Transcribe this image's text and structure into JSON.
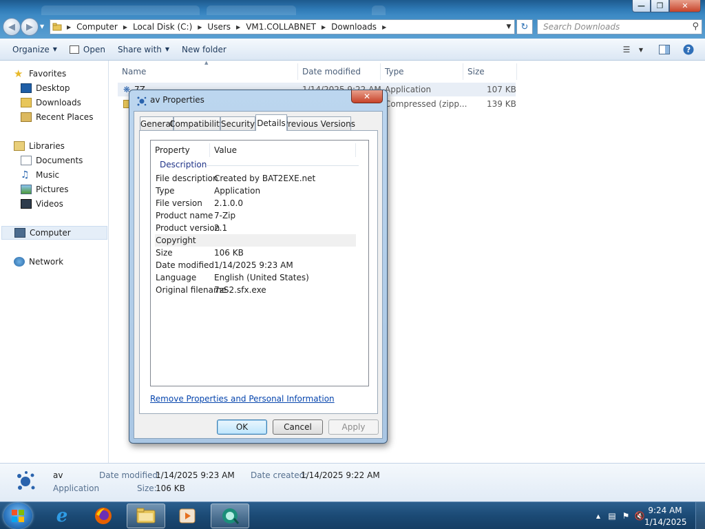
{
  "explorer": {
    "breadcrumb": [
      "Computer",
      "Local Disk (C:)",
      "Users",
      "VM1.COLLABNET",
      "Downloads"
    ],
    "search_placeholder": "Search Downloads",
    "toolbar": {
      "organize": "Organize",
      "open": "Open",
      "share_with": "Share with",
      "new_folder": "New folder"
    },
    "nav": {
      "favorites": "Favorites",
      "desktop": "Desktop",
      "downloads": "Downloads",
      "recent_places": "Recent Places",
      "libraries": "Libraries",
      "documents": "Documents",
      "music": "Music",
      "pictures": "Pictures",
      "videos": "Videos",
      "computer": "Computer",
      "network": "Network"
    },
    "columns": {
      "name": "Name",
      "date_modified": "Date modified",
      "type": "Type",
      "size": "Size"
    },
    "files": [
      {
        "name": "7Z",
        "date": "1/14/2025 9:22 AM",
        "type": "Application",
        "size": "107 KB"
      },
      {
        "name": "",
        "date": "",
        "type": "Compressed (zipp...",
        "size": "139 KB"
      }
    ]
  },
  "details_pane": {
    "name": "av",
    "type": "Application",
    "date_modified_label": "Date modified:",
    "date_modified": "1/14/2025 9:23 AM",
    "date_created_label": "Date created:",
    "date_created": "1/14/2025 9:22 AM",
    "size_label": "Size:",
    "size": "106 KB"
  },
  "dialog": {
    "title": "av Properties",
    "tabs": [
      "General",
      "Compatibility",
      "Security",
      "Details",
      "Previous Versions"
    ],
    "active_tab": "Details",
    "list_headers": {
      "property": "Property",
      "value": "Value"
    },
    "section": "Description",
    "rows": [
      {
        "key": "File description",
        "value": "Created by BAT2EXE.net"
      },
      {
        "key": "Type",
        "value": "Application"
      },
      {
        "key": "File version",
        "value": "2.1.0.0"
      },
      {
        "key": "Product name",
        "value": "7-Zip"
      },
      {
        "key": "Product version",
        "value": "2.1"
      },
      {
        "key": "Copyright",
        "value": ""
      },
      {
        "key": "Size",
        "value": "106 KB"
      },
      {
        "key": "Date modified",
        "value": "1/14/2025 9:23 AM"
      },
      {
        "key": "Language",
        "value": "English (United States)"
      },
      {
        "key": "Original filename",
        "value": "7zS2.sfx.exe"
      }
    ],
    "remove_link": "Remove Properties and Personal Information",
    "buttons": {
      "ok": "OK",
      "cancel": "Cancel",
      "apply": "Apply"
    }
  },
  "taskbar": {
    "time": "9:24 AM",
    "date": "1/14/2025"
  },
  "colors": {
    "link": "#0645ad",
    "section_header": "#1e3287",
    "titlebar": "#2e79b5"
  },
  "icons": [
    "back-arrow-icon",
    "forward-arrow-icon",
    "refresh-icon",
    "search-icon",
    "help-icon",
    "folder-icon",
    "star-icon",
    "computer-icon",
    "network-icon",
    "windows-logo-icon",
    "ie-icon",
    "firefox-icon",
    "media-player-icon"
  ]
}
